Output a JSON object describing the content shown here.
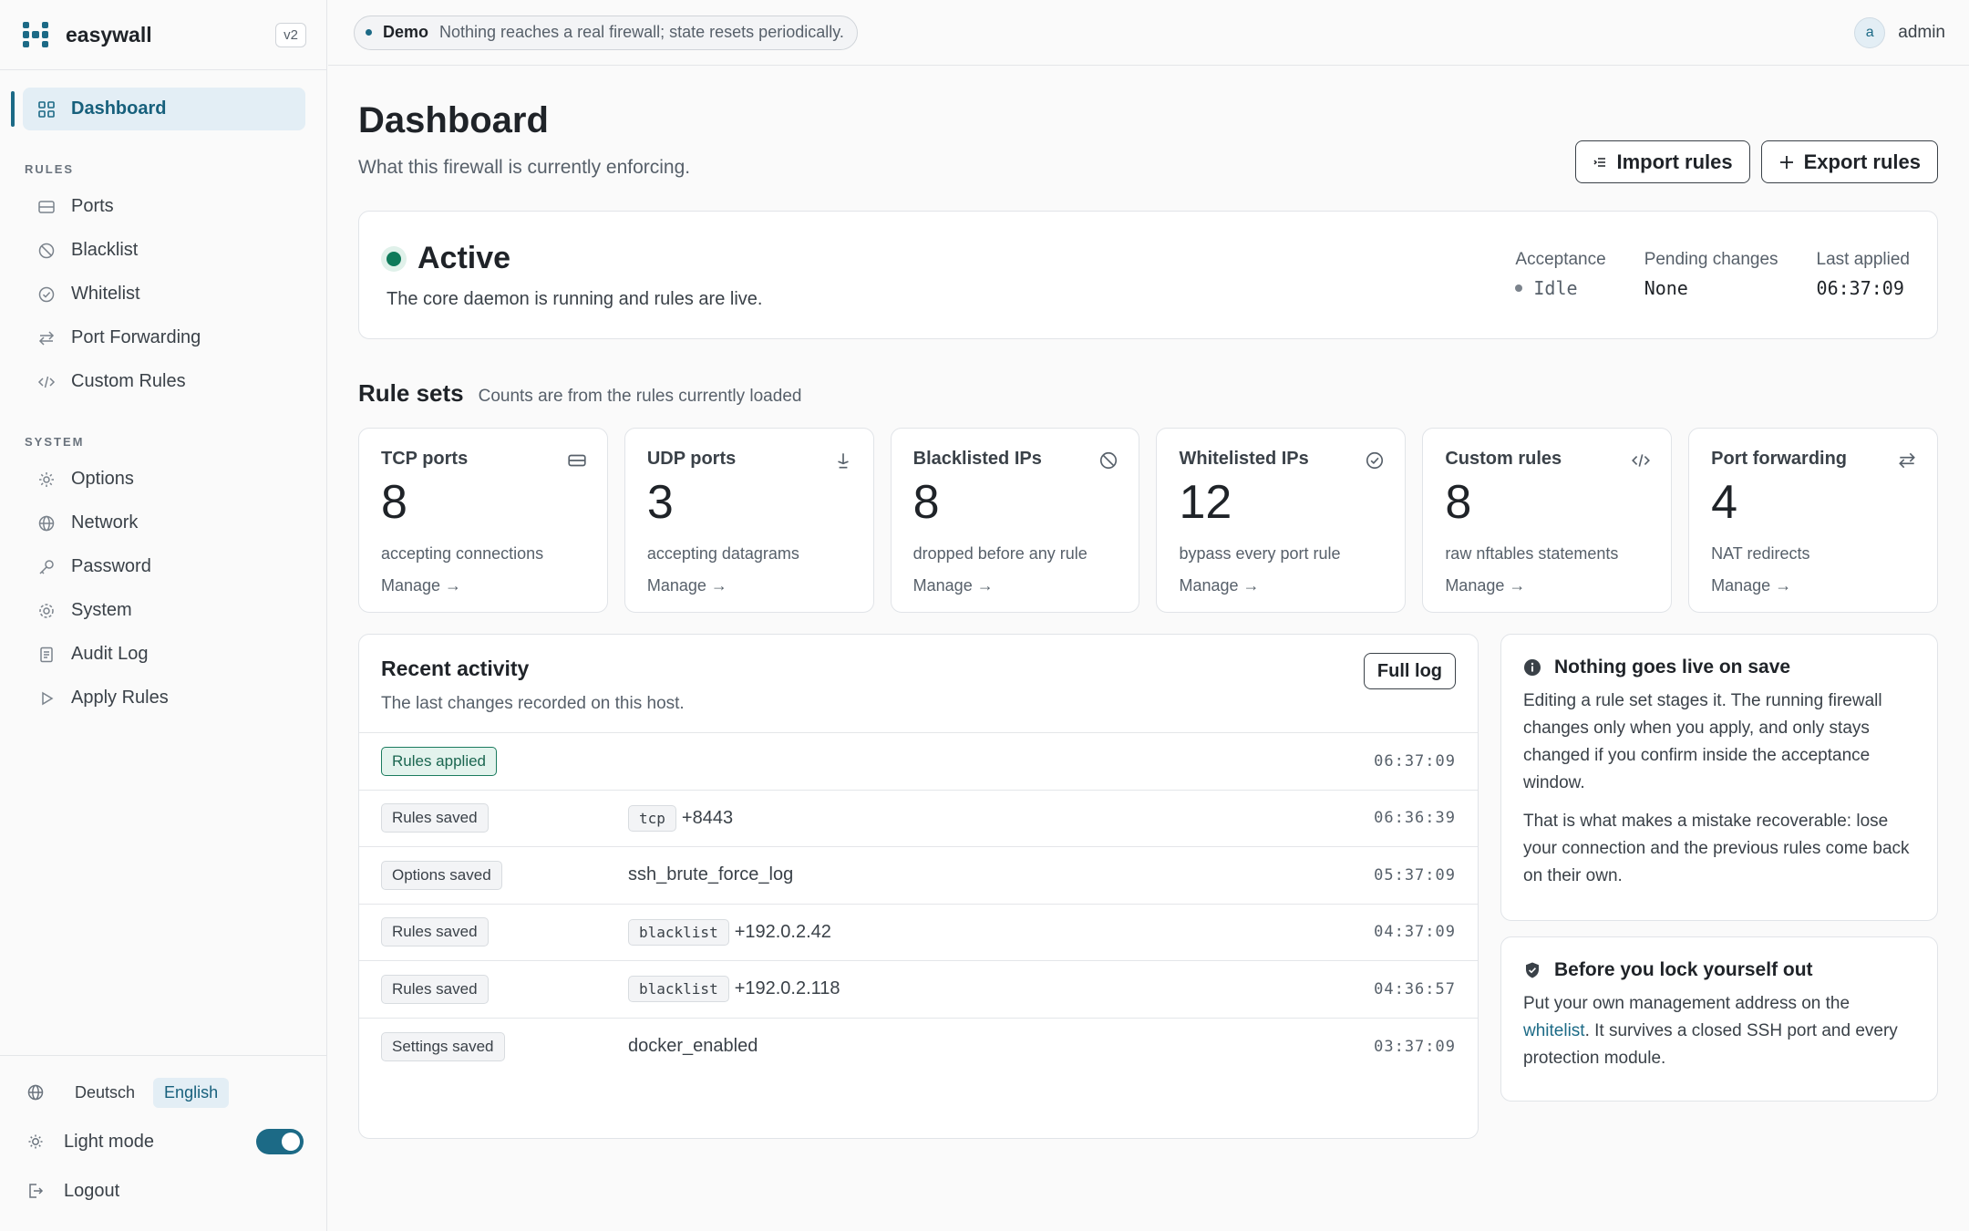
{
  "brand": {
    "name": "easywall",
    "version": "v2"
  },
  "nav": {
    "dashboard": "Dashboard",
    "rules_section": "RULES",
    "system_section": "SYSTEM",
    "rules": [
      "Ports",
      "Blacklist",
      "Whitelist",
      "Port Forwarding",
      "Custom Rules"
    ],
    "system": [
      "Options",
      "Network",
      "Password",
      "System",
      "Audit Log",
      "Apply Rules"
    ]
  },
  "sidebar_bottom": {
    "languages": [
      "Deutsch",
      "English"
    ],
    "active_language": "English",
    "theme_label": "Light mode",
    "theme_toggle_on": true,
    "logout": "Logout"
  },
  "topbar": {
    "demo_label": "Demo",
    "demo_text": "Nothing reaches a real firewall; state resets periodically.",
    "avatar_letter": "a",
    "username": "admin"
  },
  "page": {
    "title": "Dashboard",
    "subtitle": "What this firewall is currently enforcing.",
    "import_label": "Import rules",
    "export_label": "Export rules"
  },
  "status": {
    "state": "Active",
    "description": "The core daemon is running and rules are live.",
    "acceptance_label": "Acceptance",
    "acceptance_value": "Idle",
    "pending_label": "Pending changes",
    "pending_value": "None",
    "applied_label": "Last applied",
    "applied_value": "06:37:09"
  },
  "rule_sets": {
    "title": "Rule sets",
    "subtitle": "Counts are from the rules currently loaded",
    "manage_label": "Manage →",
    "cards": [
      {
        "title": "TCP ports",
        "count": "8",
        "desc": "accepting connections",
        "icon": "hdd-icon"
      },
      {
        "title": "UDP ports",
        "count": "3",
        "desc": "accepting datagrams",
        "icon": "antenna-icon"
      },
      {
        "title": "Blacklisted IPs",
        "count": "8",
        "desc": "dropped before any rule",
        "icon": "ban-icon"
      },
      {
        "title": "Whitelisted IPs",
        "count": "12",
        "desc": "bypass every port rule",
        "icon": "check-circle-icon"
      },
      {
        "title": "Custom rules",
        "count": "8",
        "desc": "raw nftables statements",
        "icon": "code-icon"
      },
      {
        "title": "Port forwarding",
        "count": "4",
        "desc": "NAT redirects",
        "icon": "arrows-icon"
      }
    ]
  },
  "activity": {
    "title": "Recent activity",
    "subtitle": "The last changes recorded on this host.",
    "full_log_label": "Full log",
    "rows": [
      {
        "event": "Rules applied",
        "tag": "",
        "detail": "",
        "time": "06:37:09",
        "highlight": true
      },
      {
        "event": "Rules saved",
        "tag": "tcp",
        "detail": "+8443",
        "time": "06:36:39"
      },
      {
        "event": "Options saved",
        "tag": "",
        "detail": "ssh_brute_force_log",
        "time": "05:37:09"
      },
      {
        "event": "Rules saved",
        "tag": "blacklist",
        "detail": "+192.0.2.42",
        "time": "04:37:09"
      },
      {
        "event": "Rules saved",
        "tag": "blacklist",
        "detail": "+192.0.2.118",
        "time": "04:36:57"
      },
      {
        "event": "Settings saved",
        "tag": "",
        "detail": "docker_enabled",
        "time": "03:37:09"
      }
    ]
  },
  "info_live": {
    "title": "Nothing goes live on save",
    "p1": "Editing a rule set stages it. The running firewall changes only when you apply, and only stays changed if you confirm inside the acceptance window.",
    "p2": "That is what makes a mistake recoverable: lose your connection and the previous rules come back on their own."
  },
  "info_lock": {
    "title": "Before you lock yourself out",
    "text_before": "Put your own management address on the ",
    "link": "whitelist",
    "text_after": ". It survives a closed SSH port and every protection module."
  },
  "colors": {
    "accent": "#1c6a86",
    "success": "#0f7a5a"
  }
}
